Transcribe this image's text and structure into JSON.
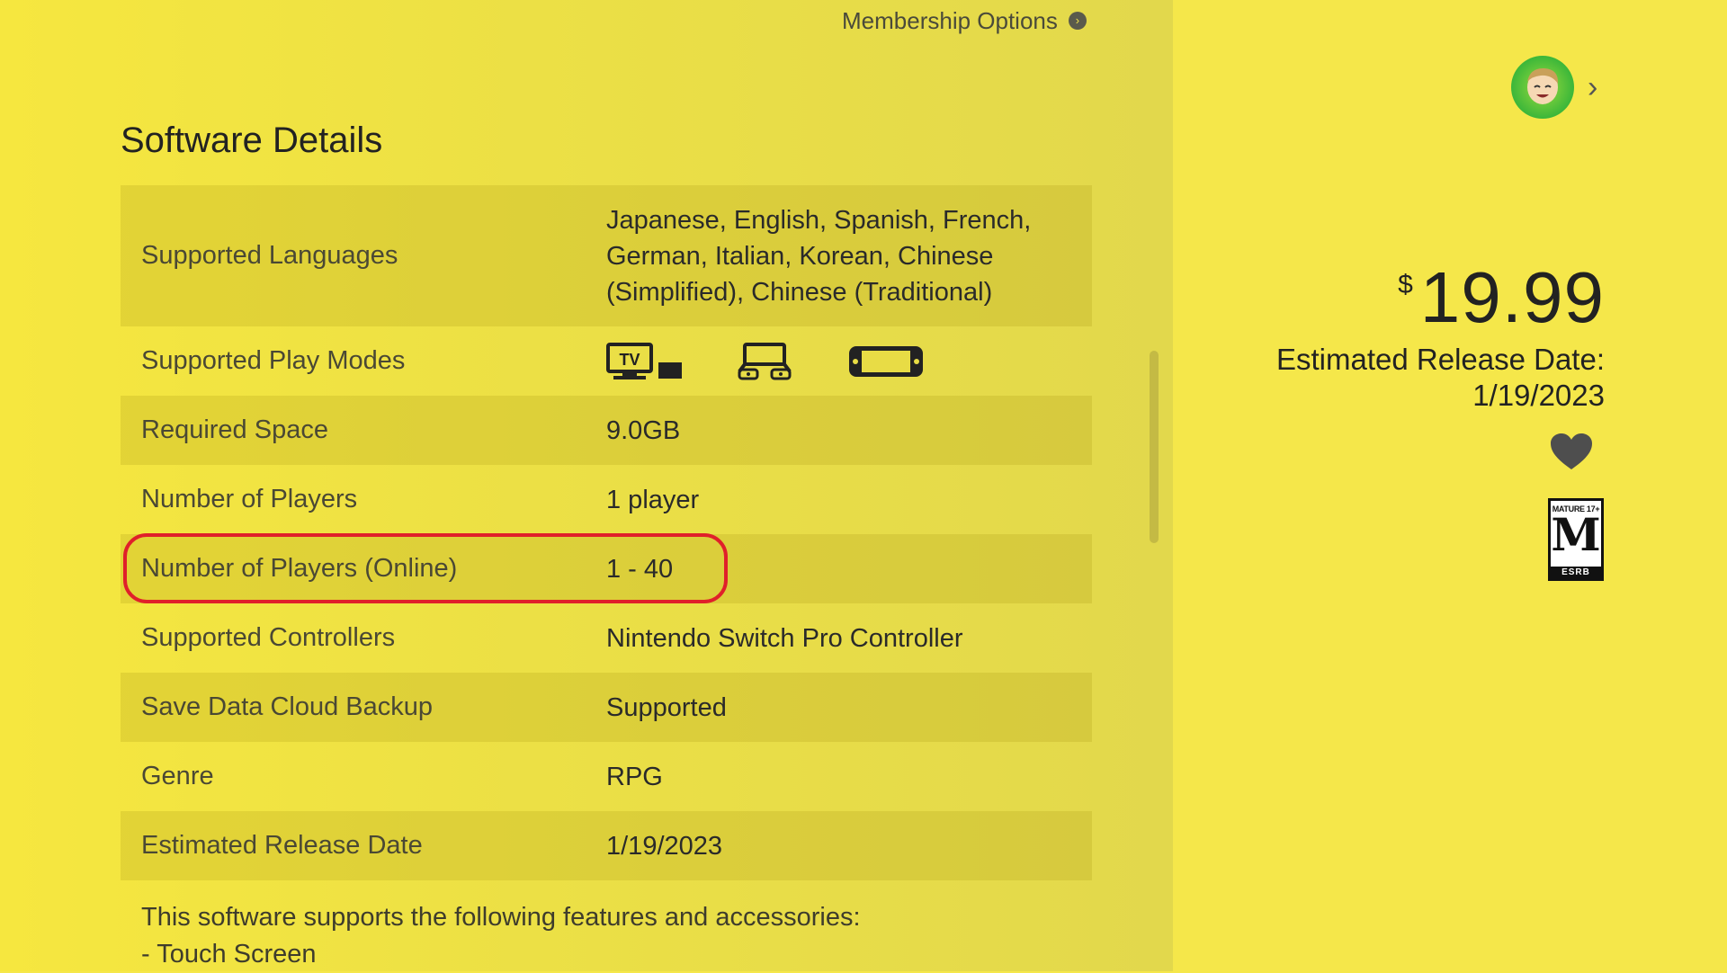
{
  "header": {
    "membership_label": "Membership Options"
  },
  "page_title": "Software Details",
  "details": [
    {
      "label": "Supported Languages",
      "value": "Japanese, English, Spanish, French, German, Italian, Korean, Chinese (Simplified), Chinese (Traditional)"
    },
    {
      "label": "Supported Play Modes",
      "value": "",
      "icons": [
        "tv-mode-icon",
        "tabletop-mode-icon",
        "handheld-mode-icon"
      ]
    },
    {
      "label": "Required Space",
      "value": "9.0GB"
    },
    {
      "label": "Number of Players",
      "value": "1 player"
    },
    {
      "label": "Number of Players (Online)",
      "value": "1 - 40"
    },
    {
      "label": "Supported Controllers",
      "value": "Nintendo Switch Pro Controller"
    },
    {
      "label": "Save Data Cloud Backup",
      "value": "Supported"
    },
    {
      "label": "Genre",
      "value": "RPG"
    },
    {
      "label": "Estimated Release Date",
      "value": "1/19/2023"
    }
  ],
  "features": {
    "intro": "This software supports the following features and accessories:",
    "items": [
      "- Touch Screen"
    ]
  },
  "purchase": {
    "currency": "$",
    "price": "19.99",
    "release_label": "Estimated Release Date:",
    "release_date": "1/19/2023"
  },
  "rating": {
    "top": "MATURE 17+",
    "letter": "M",
    "board": "ESRB"
  },
  "colors": {
    "background": "#f5e74a",
    "highlight": "#e0202a",
    "row_shade": "#d8c93a"
  }
}
